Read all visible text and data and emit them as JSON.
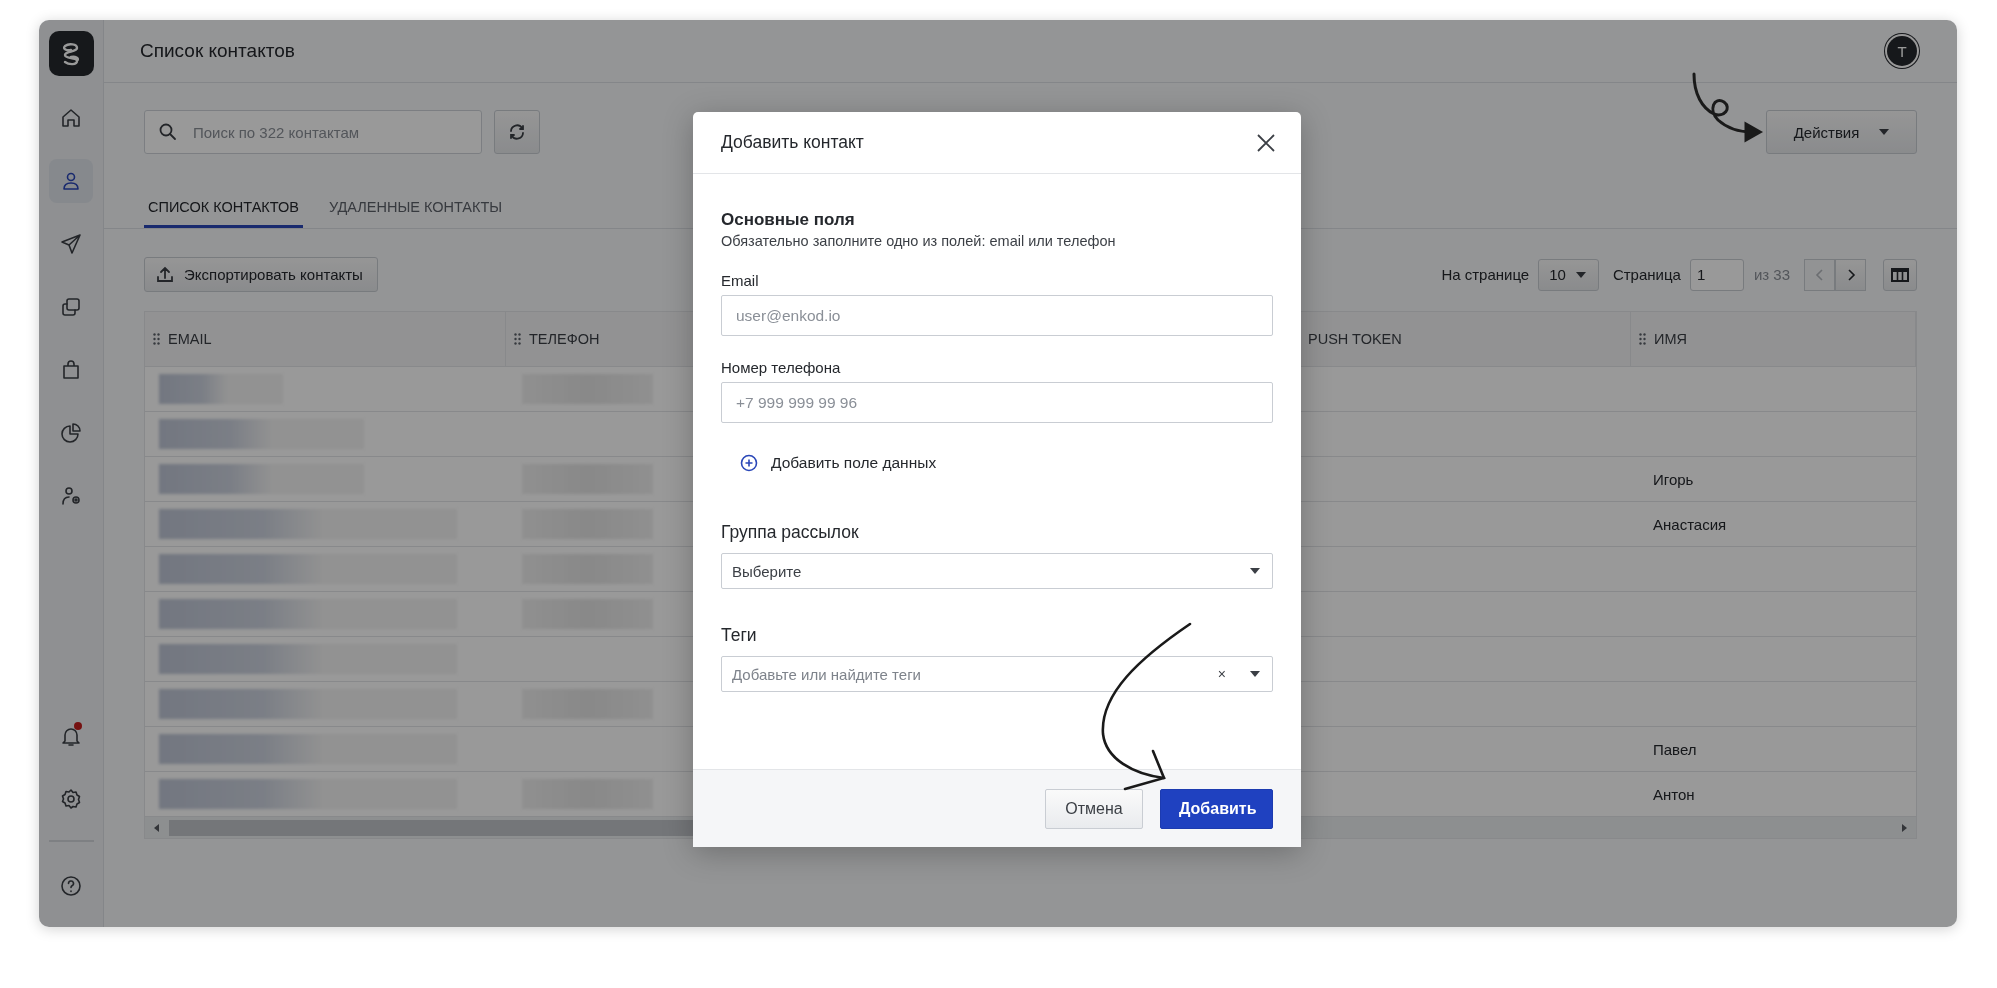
{
  "header": {
    "title": "Список контактов",
    "avatar": "T"
  },
  "sidebar": {
    "items": [
      {
        "kind": "home",
        "selected": false,
        "badge": false
      },
      {
        "kind": "contacts",
        "selected": true,
        "badge": false
      },
      {
        "kind": "send",
        "selected": false,
        "badge": false
      },
      {
        "kind": "copy",
        "selected": false,
        "badge": false
      },
      {
        "kind": "bag",
        "selected": false,
        "badge": false
      },
      {
        "kind": "chart",
        "selected": false,
        "badge": false
      },
      {
        "kind": "user-settings",
        "selected": false,
        "badge": false
      }
    ],
    "footer_items": [
      {
        "kind": "bell",
        "selected": false,
        "badge": true
      },
      {
        "kind": "settings",
        "selected": false,
        "badge": false
      },
      {
        "kind": "help",
        "selected": false,
        "badge": false
      }
    ]
  },
  "toolbar": {
    "search": {
      "placeholder": "Поиск по 322 контактам"
    },
    "actions_button": "Действия"
  },
  "tabs": [
    {
      "label": "СПИСОК КОНТАКТОВ",
      "selected": true
    },
    {
      "label": "УДАЛЕННЫЕ КОНТАКТЫ",
      "selected": false
    }
  ],
  "export_button": "Экспортировать контакты",
  "pagination": {
    "per_page_label": "На странице",
    "per_page": "10",
    "page_label": "Страница",
    "page": "1",
    "total": "из 33",
    "prev_disabled": true,
    "next_disabled": false
  },
  "table": {
    "columns": [
      {
        "label": "EMAIL",
        "handle": true
      },
      {
        "label": "ТЕЛЕФОН",
        "handle": true
      },
      {
        "label": "PUSH TOKEN",
        "handle": false
      },
      {
        "label": "ИМЯ",
        "handle": true
      }
    ],
    "rows": [
      {
        "phone": true
      },
      {
        "phone": false
      },
      {
        "phone": true,
        "name": "Игорь"
      },
      {
        "phone": true,
        "name": "Анастасия"
      },
      {
        "phone": true
      },
      {
        "phone": true
      },
      {
        "phone": false
      },
      {
        "phone": true
      },
      {
        "phone": false,
        "name": "Павел"
      },
      {
        "phone": true,
        "name": "Антон"
      }
    ]
  },
  "modal": {
    "title": "Добавить контакт",
    "section_title": "Основные поля",
    "section_hint": "Обязательно заполните одно из полей: email или телефон",
    "fields": [
      {
        "label": "Email",
        "placeholder": "user@enkod.io"
      },
      {
        "label": "Номер телефона",
        "placeholder": "+7 999 999 99 96"
      }
    ],
    "add_field": "Добавить поле данных",
    "group": {
      "label": "Группа рассылок",
      "value": "Выберите"
    },
    "tags": {
      "label": "Теги",
      "placeholder": "Добавьте или найдите теги",
      "clear": "×"
    },
    "buttons": [
      {
        "label": "Отмена",
        "kind": "secondary"
      },
      {
        "label": "Добавить",
        "kind": "primary"
      }
    ]
  }
}
